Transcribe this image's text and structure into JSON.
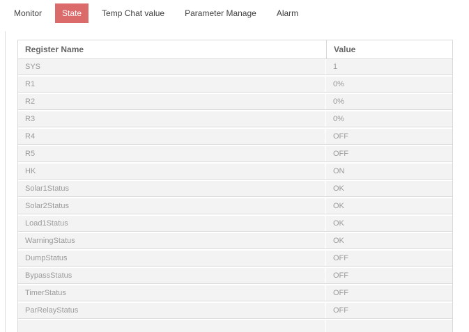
{
  "tabs": {
    "items": [
      {
        "label": "Monitor",
        "active": false
      },
      {
        "label": "State",
        "active": true
      },
      {
        "label": "Temp Chat value",
        "active": false
      },
      {
        "label": "Parameter Manage",
        "active": false
      },
      {
        "label": "Alarm",
        "active": false
      }
    ]
  },
  "table": {
    "columns": [
      "Register Name",
      "Value"
    ],
    "rows": [
      {
        "name": "SYS",
        "value": "1"
      },
      {
        "name": "R1",
        "value": "0%"
      },
      {
        "name": "R2",
        "value": "0%"
      },
      {
        "name": "R3",
        "value": "0%"
      },
      {
        "name": "R4",
        "value": "OFF"
      },
      {
        "name": "R5",
        "value": "OFF"
      },
      {
        "name": "HK",
        "value": "ON"
      },
      {
        "name": "Solar1Status",
        "value": "OK"
      },
      {
        "name": "Solar2Status",
        "value": "OK"
      },
      {
        "name": "Load1Status",
        "value": "OK"
      },
      {
        "name": "WarningStatus",
        "value": "OK"
      },
      {
        "name": "DumpStatus",
        "value": "OFF"
      },
      {
        "name": "BypassStatus",
        "value": "OFF"
      },
      {
        "name": "TimerStatus",
        "value": "OFF"
      },
      {
        "name": "ParRelayStatus",
        "value": "OFF"
      }
    ]
  },
  "colors": {
    "active_tab_bg": "#db6a6a",
    "active_tab_text": "#ffffff",
    "row_bg": "#f3f3f3",
    "row_text": "#9a9a9a",
    "header_text": "#666666",
    "table_border": "#d9d9d9"
  }
}
